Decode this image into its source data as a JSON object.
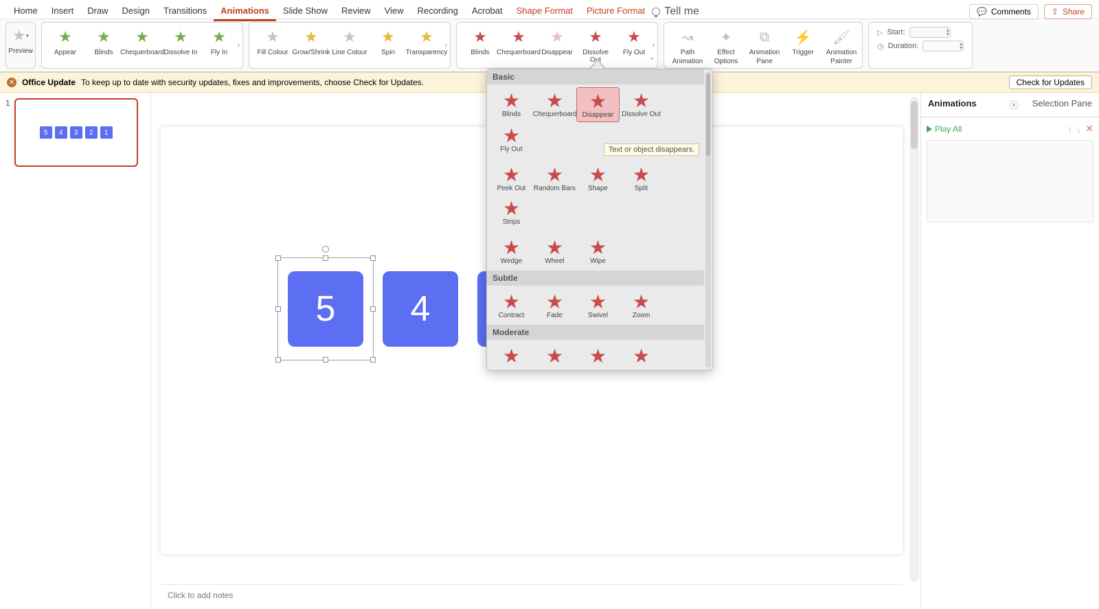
{
  "menu": {
    "tabs": [
      "Home",
      "Insert",
      "Draw",
      "Design",
      "Transitions",
      "Animations",
      "Slide Show",
      "Review",
      "View",
      "Recording",
      "Acrobat",
      "Shape Format",
      "Picture Format"
    ],
    "active": "Animations",
    "red": [
      "Shape Format",
      "Picture Format"
    ],
    "tellme": "Tell me",
    "comments": "Comments",
    "share": "Share"
  },
  "ribbon": {
    "preview": "Preview",
    "entrance": [
      {
        "label": "Appear",
        "cls": "green"
      },
      {
        "label": "Blinds",
        "cls": "green"
      },
      {
        "label": "Chequerboard",
        "cls": "green"
      },
      {
        "label": "Dissolve In",
        "cls": "green"
      },
      {
        "label": "Fly In",
        "cls": "green"
      }
    ],
    "emphasis": [
      {
        "label": "Fill Colour",
        "cls": "grey"
      },
      {
        "label": "Grow/Shrink",
        "cls": "yellow"
      },
      {
        "label": "Line Colour",
        "cls": "grey"
      },
      {
        "label": "Spin",
        "cls": "yellow"
      },
      {
        "label": "Transparency",
        "cls": "yellow"
      }
    ],
    "exit": [
      {
        "label": "Blinds",
        "cls": "red"
      },
      {
        "label": "Chequerboard",
        "cls": "red"
      },
      {
        "label": "Disappear",
        "cls": "faded-red"
      },
      {
        "label": "Dissolve Out",
        "cls": "red"
      },
      {
        "label": "Fly Out",
        "cls": "red"
      }
    ],
    "tools": [
      {
        "label1": "Path",
        "label2": "Animation"
      },
      {
        "label1": "Effect",
        "label2": "Options"
      },
      {
        "label1": "Animation",
        "label2": "Pane"
      },
      {
        "label1": "Trigger",
        "label2": ""
      },
      {
        "label1": "Animation",
        "label2": "Painter"
      }
    ],
    "timing": {
      "start": "Start:",
      "duration": "Duration:"
    }
  },
  "msg": {
    "title": "Office Update",
    "body": "To keep up to date with security updates, fixes and improvements, choose Check for Updates.",
    "btn": "Check for Updates"
  },
  "thumb": {
    "num": "1",
    "vals": [
      "5",
      "4",
      "3",
      "2",
      "1"
    ]
  },
  "slide": {
    "shapes": [
      "5",
      "4"
    ]
  },
  "notes": "Click to add notes",
  "gallery": {
    "cat1": "Basic",
    "row1": [
      {
        "label": "Blinds"
      },
      {
        "label": "Chequerboard"
      },
      {
        "label": "Disappear",
        "sel": true
      },
      {
        "label": "Dissolve Out"
      },
      {
        "label": "Fly Out"
      }
    ],
    "row2": [
      {
        "label": "Peek Out"
      },
      {
        "label": "Random Bars"
      },
      {
        "label": "Shape"
      },
      {
        "label": "Split"
      },
      {
        "label": "Strips"
      }
    ],
    "row3": [
      {
        "label": "Wedge"
      },
      {
        "label": "Wheel"
      },
      {
        "label": "Wipe"
      }
    ],
    "cat2": "Subtle",
    "row4": [
      {
        "label": "Contract"
      },
      {
        "label": "Fade"
      },
      {
        "label": "Swivel"
      },
      {
        "label": "Zoom"
      }
    ],
    "cat3": "Moderate",
    "tooltip": "Text or object disappears."
  },
  "rpane": {
    "tab1": "Animations",
    "tab2": "Selection Pane",
    "play": "Play All"
  }
}
